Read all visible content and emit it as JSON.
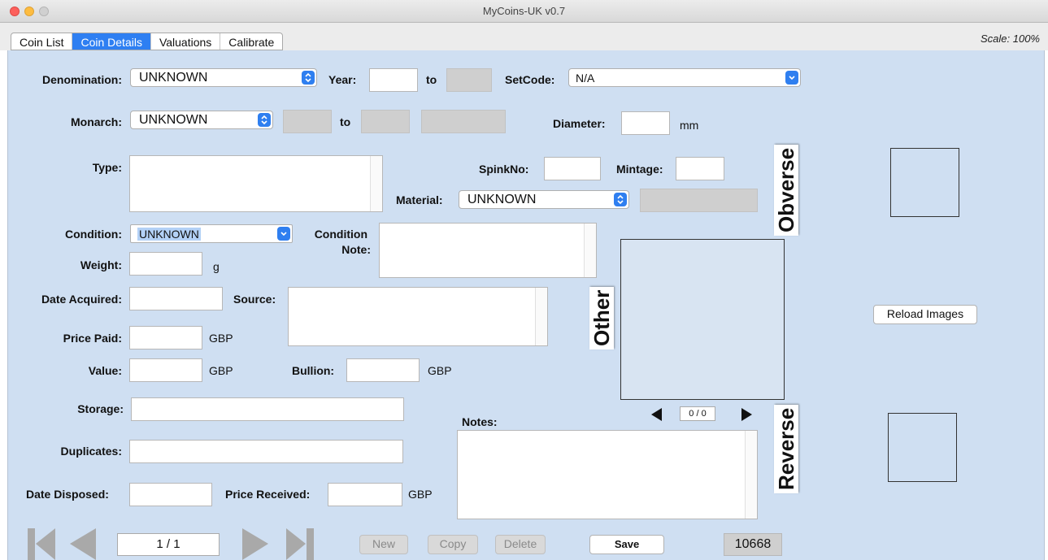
{
  "window": {
    "title": "MyCoins-UK v0.7"
  },
  "tabs": [
    {
      "label": "Coin List"
    },
    {
      "label": "Coin Details"
    },
    {
      "label": "Valuations"
    },
    {
      "label": "Calibrate"
    }
  ],
  "scale": "Scale:  100%",
  "form": {
    "denomination": {
      "label": "Denomination:",
      "value": "UNKNOWN"
    },
    "year": {
      "label": "Year:",
      "to": "to",
      "value": "",
      "to_value": ""
    },
    "setcode": {
      "label": "SetCode:",
      "value": "N/A"
    },
    "monarch": {
      "label": "Monarch:",
      "value": "UNKNOWN",
      "to": "to"
    },
    "diameter": {
      "label": "Diameter:",
      "unit": "mm",
      "value": ""
    },
    "type": {
      "label": "Type:"
    },
    "spinkno": {
      "label": "SpinkNo:",
      "value": ""
    },
    "mintage": {
      "label": "Mintage:",
      "value": ""
    },
    "material": {
      "label": "Material:",
      "value": "UNKNOWN"
    },
    "condition": {
      "label": "Condition:",
      "value": "UNKNOWN"
    },
    "condition_note": {
      "label_line1": "Condition",
      "label_line2": "Note:"
    },
    "weight": {
      "label": "Weight:",
      "unit": "g",
      "value": ""
    },
    "date_acquired": {
      "label": "Date Acquired:",
      "value": ""
    },
    "source": {
      "label": "Source:"
    },
    "price_paid": {
      "label": "Price Paid:",
      "unit": "GBP",
      "value": ""
    },
    "value": {
      "label": "Value:",
      "unit": "GBP",
      "value": ""
    },
    "bullion": {
      "label": "Bullion:",
      "unit": "GBP",
      "value": ""
    },
    "storage": {
      "label": "Storage:",
      "value": ""
    },
    "duplicates": {
      "label": "Duplicates:",
      "value": ""
    },
    "date_disposed": {
      "label": "Date Disposed:",
      "value": ""
    },
    "price_received": {
      "label": "Price Received:",
      "unit": "GBP",
      "value": ""
    },
    "notes": {
      "label": "Notes:"
    }
  },
  "images": {
    "obverse_label": "Obverse",
    "other_label": "Other",
    "reverse_label": "Reverse",
    "other_counter": "0 / 0",
    "reload_label": "Reload Images"
  },
  "navigation": {
    "record": "1 / 1",
    "new_label": "New",
    "copy_label": "Copy",
    "delete_label": "Delete",
    "save_label": "Save",
    "record_id": "10668"
  },
  "colors": {
    "pane_background": "#cfdff2",
    "accent": "#2e7ff2"
  }
}
